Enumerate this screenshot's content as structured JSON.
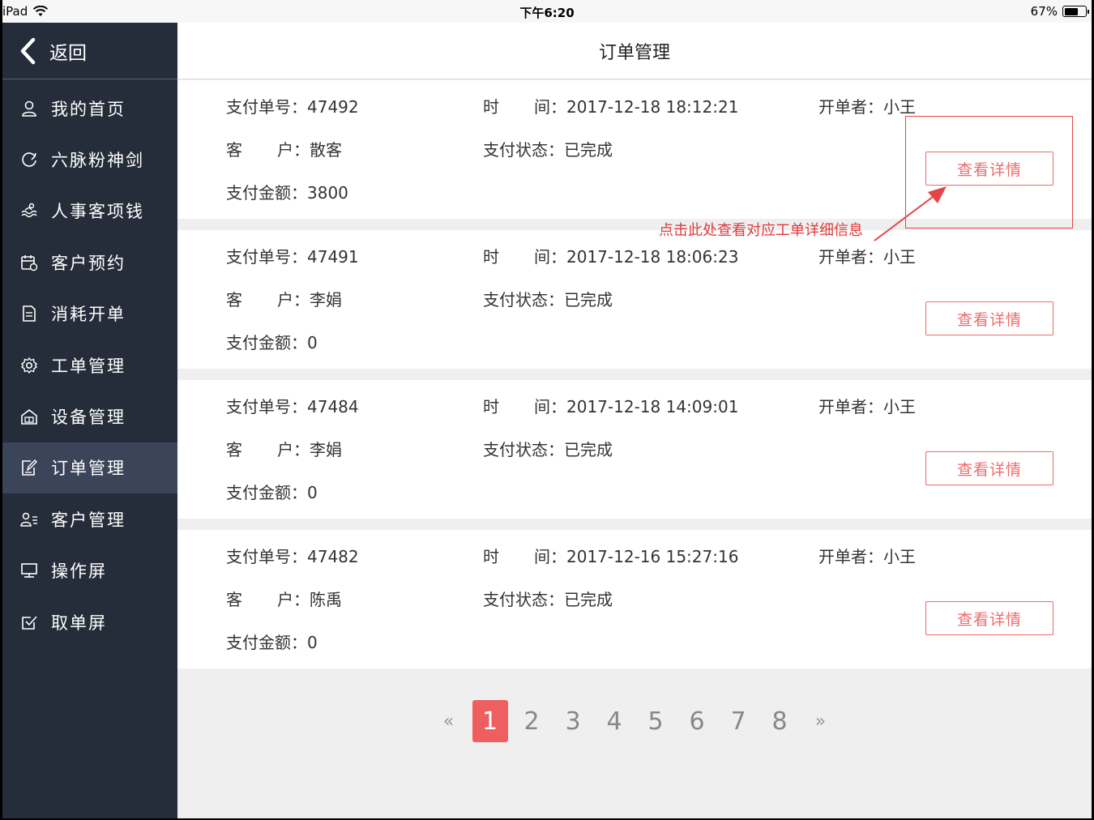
{
  "status_bar": {
    "device": "iPad",
    "time": "下午6:20",
    "battery": "67%",
    "battery_level": 0.67
  },
  "sidebar": {
    "back_label": "返回",
    "items": [
      {
        "label": "我的首页",
        "icon": "user-icon"
      },
      {
        "label": "六脉粉神剑",
        "icon": "refresh-circle-icon"
      },
      {
        "label": "人事客项钱",
        "icon": "wave-icon"
      },
      {
        "label": "客户预约",
        "icon": "calendar-icon"
      },
      {
        "label": "消耗开单",
        "icon": "document-icon"
      },
      {
        "label": "工单管理",
        "icon": "gear-icon"
      },
      {
        "label": "设备管理",
        "icon": "device-house-icon"
      },
      {
        "label": "订单管理",
        "icon": "edit-note-icon",
        "active": true
      },
      {
        "label": "客户管理",
        "icon": "user-list-icon"
      },
      {
        "label": "操作屏",
        "icon": "monitor-icon"
      },
      {
        "label": "取单屏",
        "icon": "check-box-icon"
      }
    ]
  },
  "header": {
    "title": "订单管理"
  },
  "labels": {
    "order_no": "支付单号：",
    "time_a": "时",
    "time_b": "间：",
    "operator": "开单者：",
    "customer_a": "客",
    "customer_b": "户：",
    "status": "支付状态：",
    "amount": "支付金额：",
    "detail_button": "查看详情"
  },
  "orders": [
    {
      "order_no": "47492",
      "time": "2017-12-18 18:12:21",
      "operator": "小王",
      "customer": "散客",
      "status": "已完成",
      "amount": "3800"
    },
    {
      "order_no": "47491",
      "time": "2017-12-18 18:06:23",
      "operator": "小王",
      "customer": "李娟",
      "status": "已完成",
      "amount": "0"
    },
    {
      "order_no": "47484",
      "time": "2017-12-18 14:09:01",
      "operator": "小王",
      "customer": "李娟",
      "status": "已完成",
      "amount": "0"
    },
    {
      "order_no": "47482",
      "time": "2017-12-16 15:27:16",
      "operator": "小王",
      "customer": "陈禹",
      "status": "已完成",
      "amount": "0"
    }
  ],
  "pagination": {
    "prev": "«",
    "next": "»",
    "pages": [
      "1",
      "2",
      "3",
      "4",
      "5",
      "6",
      "7",
      "8"
    ],
    "current": "1"
  },
  "annotation": {
    "text": "点击此处查看对应工单详细信息",
    "color": "#e03a3a"
  },
  "colors": {
    "sidebar_bg": "#262d3a",
    "sidebar_active": "#3a4559",
    "accent": "#f06a6a"
  }
}
